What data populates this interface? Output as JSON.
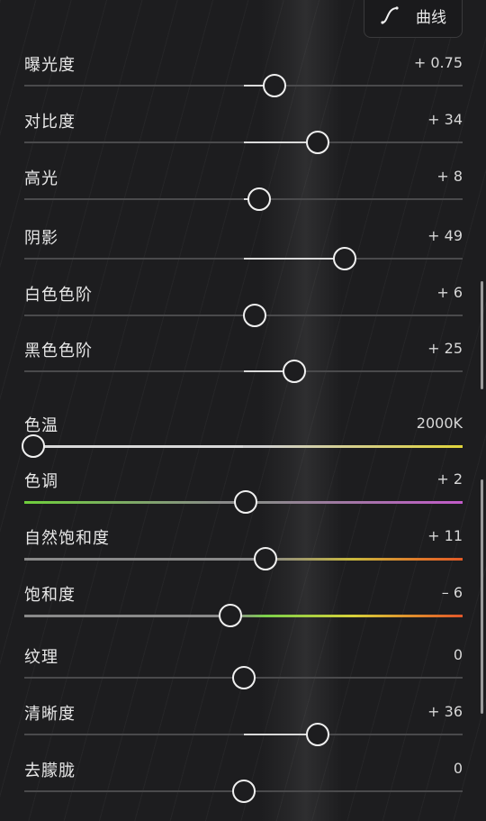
{
  "curve_button": {
    "label": "曲线",
    "icon": "curve-icon"
  },
  "sliders": [
    {
      "id": "exposure",
      "label": "曝光度",
      "value": "+ 0.75",
      "level": 0.57
    },
    {
      "id": "contrast",
      "label": "对比度",
      "value": "+ 34",
      "level": 0.67
    },
    {
      "id": "highlights",
      "label": "高光",
      "value": "+ 8",
      "level": 0.535
    },
    {
      "id": "shadows",
      "label": "阴影",
      "value": "+ 49",
      "level": 0.73
    },
    {
      "id": "whites",
      "label": "白色色阶",
      "value": "+ 6",
      "level": 0.525
    },
    {
      "id": "blacks",
      "label": "黑色色阶",
      "value": "+ 25",
      "level": 0.615
    },
    {
      "id": "temperature",
      "label": "色温",
      "value": "2000K",
      "level": 0.02
    },
    {
      "id": "tint",
      "label": "色调",
      "value": "+ 2",
      "level": 0.505
    },
    {
      "id": "vibrance",
      "label": "自然饱和度",
      "value": "+ 11",
      "level": 0.55
    },
    {
      "id": "saturation",
      "label": "饱和度",
      "value": "– 6",
      "level": 0.47
    },
    {
      "id": "texture",
      "label": "纹理",
      "value": "0",
      "level": 0.5
    },
    {
      "id": "clarity",
      "label": "清晰度",
      "value": "+ 36",
      "level": 0.67
    },
    {
      "id": "dehaze",
      "label": "去朦胧",
      "value": "0",
      "level": 0.5
    }
  ]
}
